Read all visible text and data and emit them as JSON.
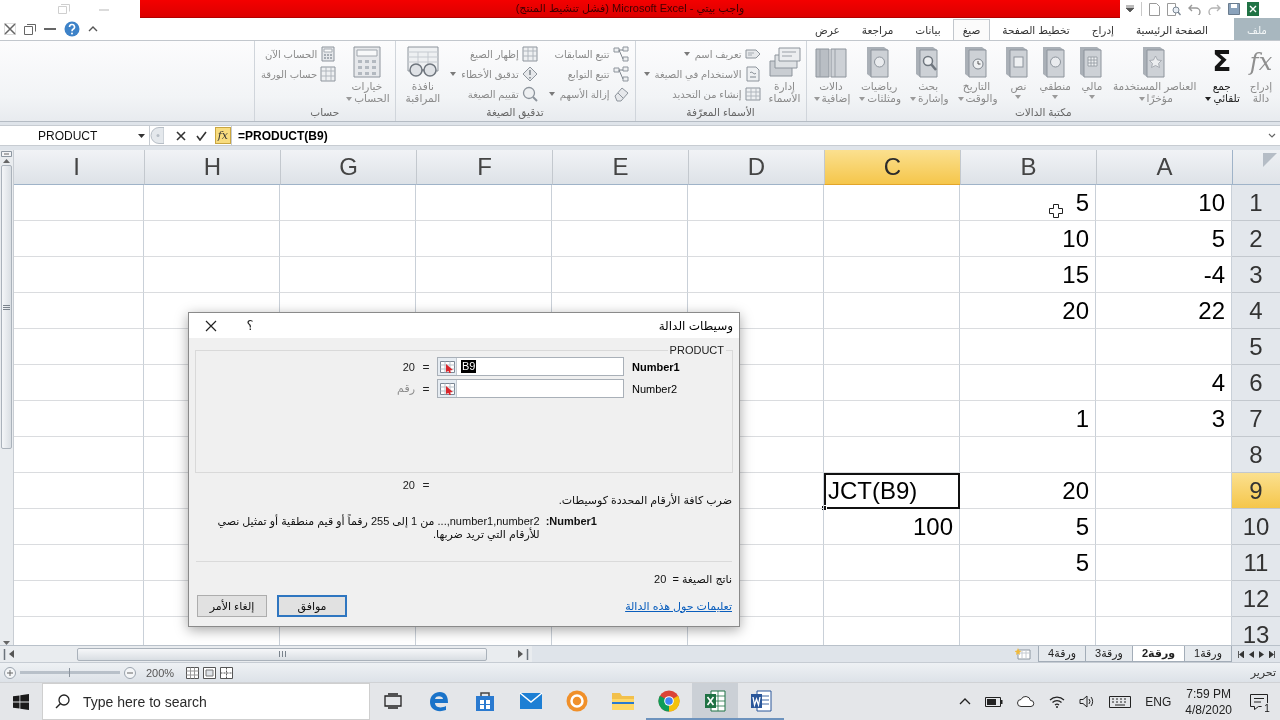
{
  "title_bar": {
    "title": "واجب بيتي - Microsoft Excel (فشل تنشيط المنتج)"
  },
  "ribbon_tabs": [
    {
      "label": "ملف",
      "kind": "file",
      "selected": false
    },
    {
      "label": "الصفحة الرئيسية",
      "kind": "tab",
      "selected": false
    },
    {
      "label": "إدراج",
      "kind": "tab",
      "selected": false
    },
    {
      "label": "تخطيط الصفحة",
      "kind": "tab",
      "selected": false
    },
    {
      "label": "صيغ",
      "kind": "tab",
      "selected": true
    },
    {
      "label": "بيانات",
      "kind": "tab",
      "selected": false
    },
    {
      "label": "مراجعة",
      "kind": "tab",
      "selected": false
    },
    {
      "label": "عرض",
      "kind": "tab",
      "selected": false
    }
  ],
  "ribbon": {
    "groups": [
      {
        "title": "مكتبة الدالات",
        "items": [
          {
            "kind": "large",
            "label": "إدراج\nدالة",
            "glyph": "fx",
            "disabled": true,
            "dropdown": false
          },
          {
            "kind": "large",
            "label": "جمع\nتلقائي",
            "glyph": "Σ",
            "disabled": false,
            "dropdown": true
          },
          {
            "kind": "large",
            "label": "العناصر المستخدمة\nمؤخرًا",
            "disabled": true,
            "dropdown": true
          },
          {
            "kind": "large",
            "label": "مالي",
            "disabled": true,
            "dropdown": true
          },
          {
            "kind": "large",
            "label": "منطقي",
            "disabled": true,
            "dropdown": true
          },
          {
            "kind": "large",
            "label": "نص",
            "disabled": true,
            "dropdown": true
          },
          {
            "kind": "large",
            "label": "التاريخ\nوالوقت",
            "disabled": true,
            "dropdown": true
          },
          {
            "kind": "large",
            "label": "بحث\nوإشارة",
            "disabled": true,
            "dropdown": true
          },
          {
            "kind": "large",
            "label": "رياضيات\nومثلثات",
            "disabled": true,
            "dropdown": true
          },
          {
            "kind": "large",
            "label": "دالات\nإضافية",
            "disabled": true,
            "dropdown": true
          }
        ]
      },
      {
        "title": "الأسماء المعرّفة",
        "items": [
          {
            "kind": "large",
            "label": "إدارة\nالأسماء",
            "disabled": true,
            "dropdown": false
          },
          {
            "kind": "stack",
            "items": [
              {
                "label": "تعريف اسم",
                "disabled": true,
                "dropdown": true
              },
              {
                "label": "الاستخدام في الصيغة",
                "disabled": true,
                "dropdown": true
              },
              {
                "label": "إنشاء من التحديد",
                "disabled": true,
                "dropdown": false
              }
            ]
          }
        ]
      },
      {
        "title": "تدقيق الصيغة",
        "items": [
          {
            "kind": "stack",
            "items": [
              {
                "label": "تتبع السابقات",
                "disabled": true,
                "dropdown": false
              },
              {
                "label": "تتبع التوابع",
                "disabled": true,
                "dropdown": false
              },
              {
                "label": "إزالة الأسهم",
                "disabled": true,
                "dropdown": true
              }
            ]
          },
          {
            "kind": "stack",
            "items": [
              {
                "label": "إظهار الصيغ",
                "disabled": true,
                "dropdown": false
              },
              {
                "label": "تدقيق الأخطاء",
                "disabled": true,
                "dropdown": true
              },
              {
                "label": "تقييم الصيغة",
                "disabled": true,
                "dropdown": false
              }
            ]
          },
          {
            "kind": "large",
            "label": "نافذة\nالمراقبة",
            "disabled": true,
            "dropdown": false
          }
        ]
      },
      {
        "title": "حساب",
        "items": [
          {
            "kind": "large",
            "label": "خيارات\nالحساب",
            "disabled": true,
            "dropdown": true
          },
          {
            "kind": "stack",
            "items": [
              {
                "label": "الحساب الآن",
                "disabled": true,
                "dropdown": false
              },
              {
                "label": "حساب الورقة",
                "disabled": true,
                "dropdown": false
              }
            ]
          }
        ]
      }
    ]
  },
  "formula_bar": {
    "name_box": "PRODUCT",
    "function_glyph": "fx",
    "formula": "=PRODUCT(B9)"
  },
  "sheet": {
    "columns": [
      {
        "label": "A",
        "selected": false
      },
      {
        "label": "B",
        "selected": false
      },
      {
        "label": "C",
        "selected": true
      },
      {
        "label": "D",
        "selected": false
      },
      {
        "label": "E",
        "selected": false
      },
      {
        "label": "F",
        "selected": false
      },
      {
        "label": "G",
        "selected": false
      },
      {
        "label": "H",
        "selected": false
      },
      {
        "label": "I",
        "selected": false
      }
    ],
    "rows": [
      {
        "label": "1",
        "selected": false,
        "cells": [
          {
            "value": "10",
            "selected": false
          },
          {
            "value": "5",
            "selected": false
          }
        ]
      },
      {
        "label": "2",
        "selected": false,
        "cells": [
          {
            "value": "5",
            "selected": false
          },
          {
            "value": "10",
            "selected": false
          }
        ]
      },
      {
        "label": "3",
        "selected": false,
        "cells": [
          {
            "value": "-4",
            "selected": false
          },
          {
            "value": "15",
            "selected": false
          }
        ]
      },
      {
        "label": "4",
        "selected": false,
        "cells": [
          {
            "value": "22",
            "selected": false
          },
          {
            "value": "20",
            "selected": false
          }
        ]
      },
      {
        "label": "5",
        "selected": false
      },
      {
        "label": "6",
        "selected": false,
        "cells": [
          {
            "value": "4",
            "selected": false
          }
        ]
      },
      {
        "label": "7",
        "selected": false,
        "cells": [
          {
            "value": "3",
            "selected": false
          },
          {
            "value": "1",
            "selected": false
          }
        ]
      },
      {
        "label": "8",
        "selected": false
      },
      {
        "label": "9",
        "selected": true,
        "cells": [
          null,
          {
            "value": "20",
            "selected": false
          },
          {
            "value": "JCT(B9)",
            "selected": true
          }
        ]
      },
      {
        "label": "10",
        "selected": false,
        "cells": [
          null,
          {
            "value": "5",
            "selected": false
          },
          {
            "value": "100",
            "selected": false
          }
        ]
      },
      {
        "label": "11",
        "selected": false,
        "cells": [
          null,
          {
            "value": "5",
            "selected": false
          }
        ]
      },
      {
        "label": "12",
        "selected": false
      },
      {
        "label": "13",
        "selected": false
      }
    ]
  },
  "sheet_tabs": [
    {
      "label": "ورقة1",
      "selected": false
    },
    {
      "label": "ورقة2",
      "selected": true
    },
    {
      "label": "ورقة3",
      "selected": false
    },
    {
      "label": "ورقة4",
      "selected": false
    }
  ],
  "status_bar": {
    "mode": "تحرير",
    "zoom": "200%"
  },
  "dialog": {
    "title": "وسيطات الدالة",
    "help": "؟",
    "function_name": "PRODUCT",
    "arguments": [
      {
        "label": "Number1",
        "active": true,
        "value": "B9",
        "value_selected": true,
        "sign": "=",
        "result": "20"
      },
      {
        "label": "Number2",
        "active": false,
        "sign": "=",
        "result_hint": "رقم"
      }
    ],
    "preview": {
      "sign": "=",
      "value": "20"
    },
    "description": "ضرب كافة الأرقام المحددة كوسيطات.",
    "argument_help": {
      "label": "Number1:",
      "text": "number1,number2,... من 1 إلى 255 رقماً أو قيم منطقية أو تمثيل نصي للأرقام التي تريد ضربها."
    },
    "formula_result": "ناتج الصيغة =  20",
    "help_link": "تعليمات حول هذه الدالة",
    "buttons": [
      {
        "label": "موافق",
        "default": true
      },
      {
        "label": "إلغاء الأمر",
        "default": false
      }
    ]
  },
  "taskbar": {
    "search_placeholder": "Type here to search",
    "apps": [
      {
        "running": false,
        "active": false
      },
      {
        "running": false,
        "active": false
      },
      {
        "running": false,
        "active": false
      },
      {
        "running": false,
        "active": false
      },
      {
        "running": false,
        "active": false
      },
      {
        "running": false,
        "active": false
      },
      {
        "running": true,
        "active": false
      },
      {
        "running": true,
        "active": true
      },
      {
        "running": true,
        "active": false
      }
    ],
    "language": "ENG",
    "time": "7:59 PM",
    "date": "4/8/2020",
    "notification_count": "1"
  }
}
